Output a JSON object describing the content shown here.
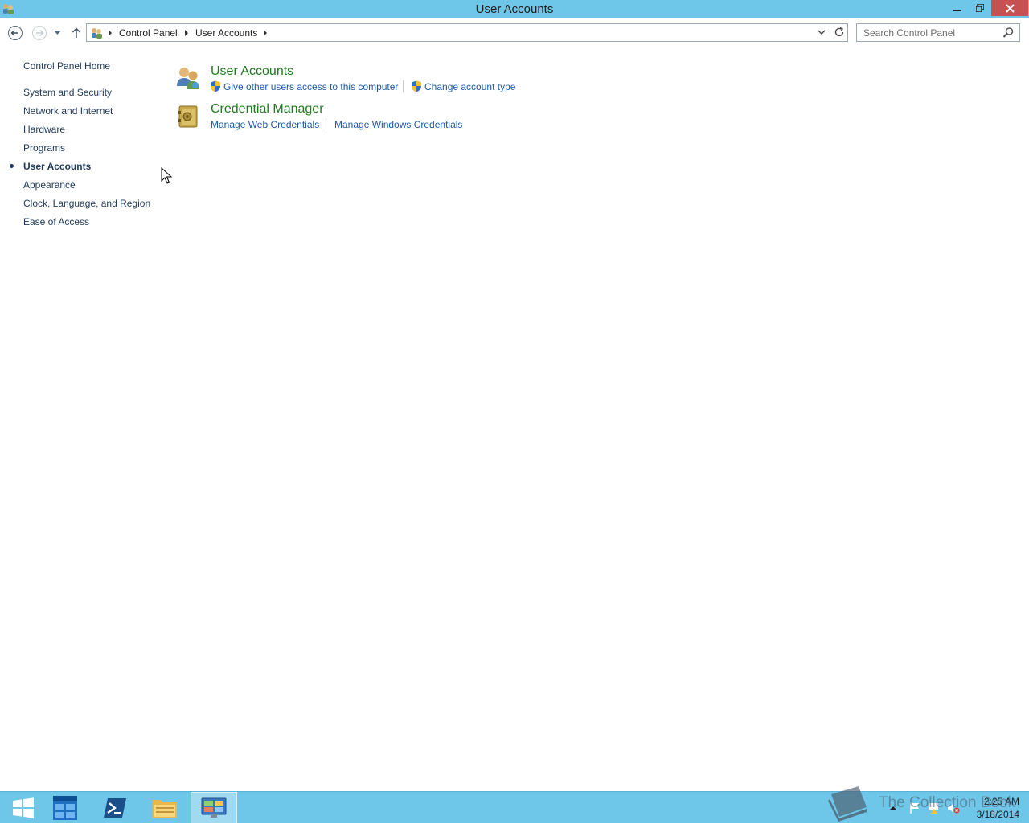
{
  "window": {
    "title": "User Accounts"
  },
  "navigation": {
    "breadcrumbs": [
      "Control Panel",
      "User Accounts"
    ],
    "search_placeholder": "Search Control Panel"
  },
  "sidebar": {
    "items": [
      {
        "label": "Control Panel Home",
        "active": false
      },
      {
        "label": "System and Security",
        "active": false
      },
      {
        "label": "Network and Internet",
        "active": false
      },
      {
        "label": "Hardware",
        "active": false
      },
      {
        "label": "Programs",
        "active": false
      },
      {
        "label": "User Accounts",
        "active": true
      },
      {
        "label": "Appearance",
        "active": false
      },
      {
        "label": "Clock, Language, and Region",
        "active": false
      },
      {
        "label": "Ease of Access",
        "active": false
      }
    ]
  },
  "categories": [
    {
      "title": "User Accounts",
      "icon": "users-icon",
      "tasks": [
        "Give other users access to this computer",
        "Change account type"
      ]
    },
    {
      "title": "Credential Manager",
      "icon": "vault-icon",
      "tasks": [
        "Manage Web Credentials",
        "Manage Windows Credentials"
      ]
    }
  ],
  "taskbar": {
    "time": "2:25 AM",
    "date": "3/18/2014"
  },
  "watermark": {
    "text": "The Collection Book"
  },
  "colors": {
    "titlebar": "#6ec6e8",
    "category_title": "#1f7a1f",
    "task_link": "#1e5aa6",
    "sidebar_link": "#1e395b"
  }
}
